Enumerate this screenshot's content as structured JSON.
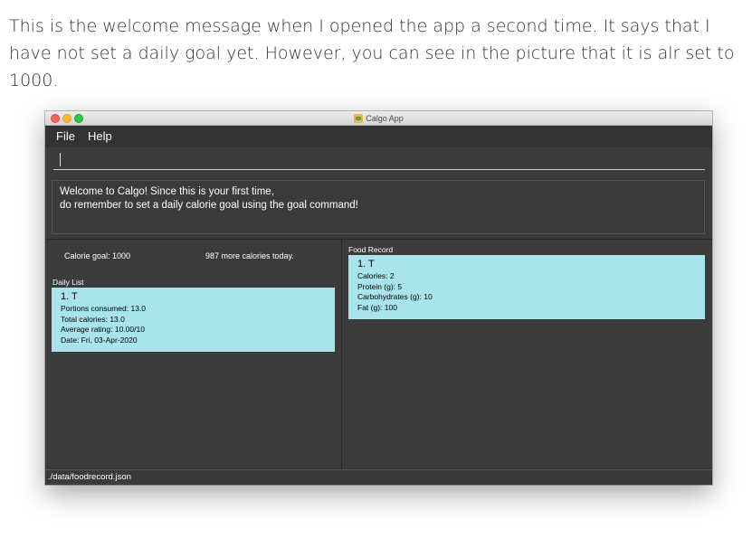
{
  "caption": "This is the welcome message when I opened the app a second time. It says that I have not set a daily goal yet. However, you can see in the picture that it is alr set to 1000.",
  "window": {
    "title": "Calgo App",
    "app_icon": "calgo-app-icon"
  },
  "menu": {
    "file": "File",
    "help": "Help"
  },
  "command": {
    "value": "",
    "placeholder": ""
  },
  "result": {
    "line1": "Welcome to Calgo! Since this is your first time,",
    "line2": "do remember to set a daily calorie goal using the goal command!"
  },
  "goal": {
    "label": "Calorie goal: 1000",
    "remaining": "987 more calories today."
  },
  "daily_list": {
    "heading": "Daily List",
    "items": [
      {
        "title": "1.  T",
        "portions": "Portions consumed: 13.0",
        "total": "Total calories: 13.0",
        "rating": "Average rating: 10.00/10",
        "date": "Date: Fri, 03-Apr-2020"
      }
    ]
  },
  "food_record": {
    "heading": "Food Record",
    "items": [
      {
        "title": "1.  T",
        "calories": "Calories: 2",
        "protein": "Protein (g): 5",
        "carbs": "Carbohydrates (g): 10",
        "fat": "Fat (g): 100"
      }
    ]
  },
  "status": {
    "path": "./data/foodrecord.json"
  },
  "colors": {
    "card_bg": "#a8e4ec",
    "window_bg": "#3b3b3b",
    "menubar_bg": "#333333"
  }
}
